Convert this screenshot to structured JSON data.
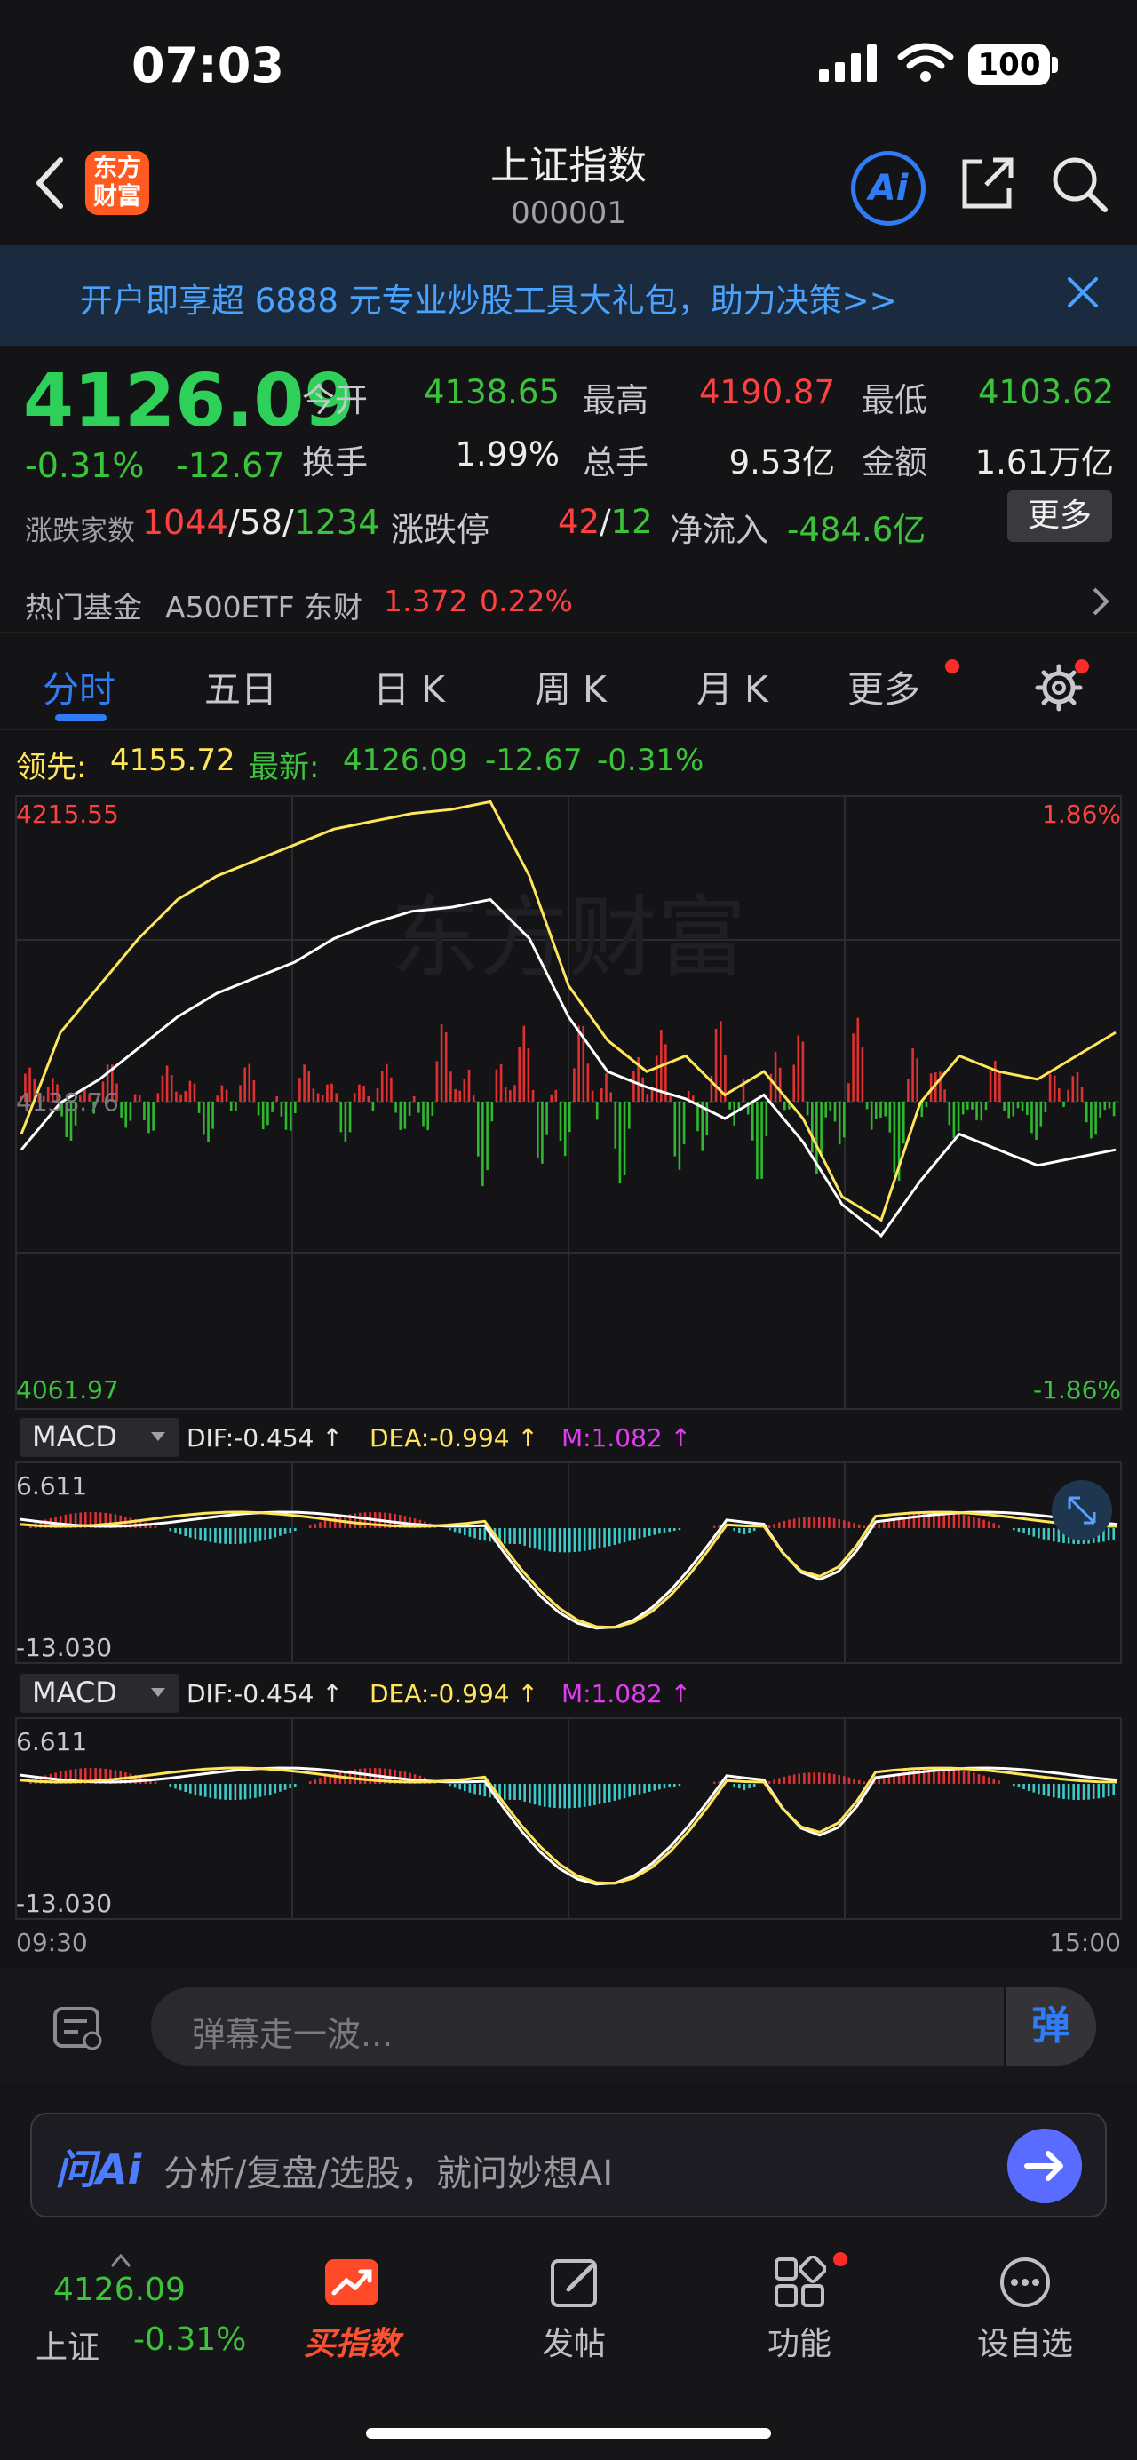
{
  "status": {
    "time": "07:03",
    "battery": "100"
  },
  "header": {
    "logo_line1": "东方",
    "logo_line2": "财富",
    "title": "上证指数",
    "code": "000001",
    "ai_label": "Ai"
  },
  "banner": {
    "text": "开户即享超 6888 元专业炒股工具大礼包，助力决策>>"
  },
  "quote": {
    "price": "4126.09",
    "change_pct": "-0.31%",
    "change_abs": "-12.67",
    "open_label": "今开",
    "open": "4138.65",
    "high_label": "最高",
    "high": "4190.87",
    "low_label": "最低",
    "low": "4103.62",
    "turnover_label": "换手",
    "turnover": "1.99%",
    "volume_label": "总手",
    "volume": "9.53亿",
    "amount_label": "金额",
    "amount": "1.61万亿",
    "breadth_label": "涨跌家数",
    "up": "1044",
    "flat": "58",
    "down": "1234",
    "slash": "/",
    "limit_label": "涨跌停",
    "limit_up": "42",
    "limit_down": "12",
    "inflow_label": "净流入",
    "inflow": "-484.6亿",
    "more": "更多"
  },
  "fund": {
    "label": "热门基金",
    "name": "A500ETF 东财",
    "price": "1.372",
    "pct": "0.22%"
  },
  "tabs": [
    "分时",
    "五日",
    "日 K",
    "周 K",
    "月 K",
    "更多"
  ],
  "info": {
    "lead_label": "领先:",
    "lead": "4155.72",
    "latest_label": "最新:",
    "latest": "4126.09",
    "chg": "-12.67",
    "pct": "-0.31%"
  },
  "chart": {
    "y_top": "4215.55",
    "y_mid": "4138.76",
    "y_bottom": "4061.97",
    "pct_top": "1.86%",
    "pct_bottom": "-1.86%",
    "watermark": "东方财富",
    "time_start": "09:30",
    "time_end": "15:00",
    "macd_label": "MACD",
    "dif": "DIF:-0.454 ↑",
    "dea": "DEA:-0.994 ↑",
    "m": "M:1.082 ↑",
    "macd_top": "6.611",
    "macd_bottom": "-13.030"
  },
  "chart_data": {
    "type": "line",
    "series": [
      {
        "name": "最新",
        "color": "#ffffff",
        "values": [
          4126,
          4138,
          4144,
          4152,
          4160,
          4166,
          4170,
          4174,
          4180,
          4184,
          4187,
          4188,
          4190,
          4180,
          4160,
          4146,
          4142,
          4139,
          4134,
          4140,
          4128,
          4112,
          4104,
          4118,
          4130,
          4126,
          4122,
          4124,
          4126
        ]
      },
      {
        "name": "领先",
        "color": "#ffe55a",
        "values": [
          4130,
          4156,
          4168,
          4180,
          4190,
          4196,
          4200,
          4204,
          4208,
          4210,
          4212,
          4213,
          4215,
          4196,
          4168,
          4154,
          4146,
          4150,
          4140,
          4146,
          4134,
          4114,
          4108,
          4138,
          4150,
          4146,
          4144,
          4150,
          4156
        ]
      }
    ],
    "ylim": [
      4061.97,
      4215.55
    ]
  },
  "danmu": {
    "placeholder": "弹幕走一波...",
    "send": "弹"
  },
  "ask": {
    "logo": "问Ai",
    "placeholder": "分析/复盘/选股，就问妙想AI"
  },
  "tabbar": {
    "index_price": "4126.09",
    "index_name": "上证",
    "index_pct": "-0.31%",
    "buy_index": "买指数",
    "post": "发帖",
    "features": "功能",
    "watchlist": "设自选"
  }
}
